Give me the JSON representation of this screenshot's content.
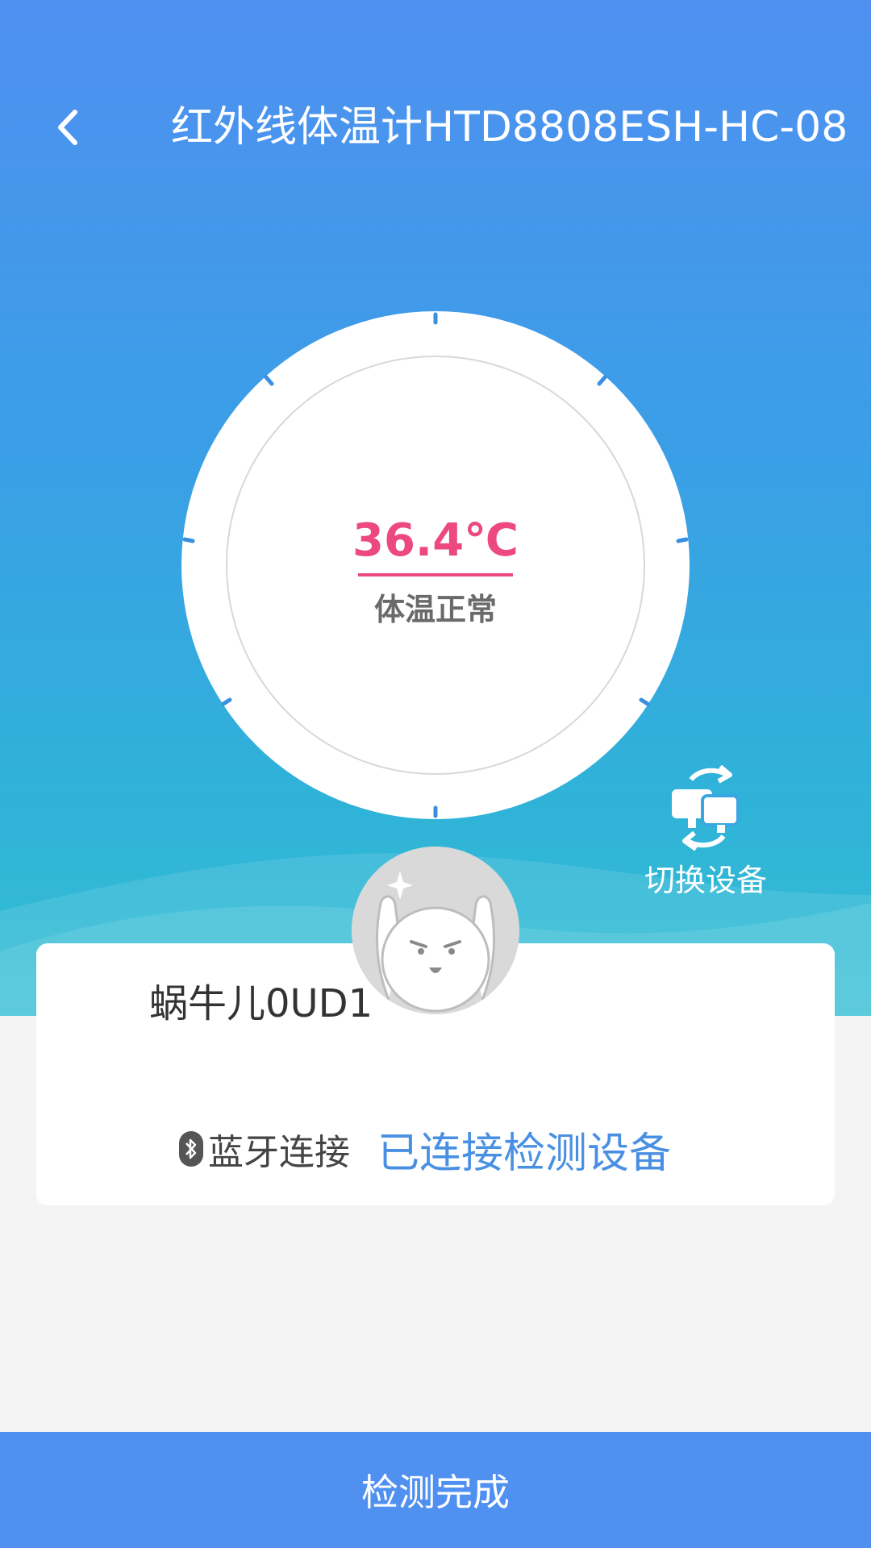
{
  "header": {
    "back_icon": "chevron-left-icon",
    "title": "红外线体温计HTD8808ESH-HC-08"
  },
  "reading": {
    "temperature": "36.4℃",
    "status": "体温正常"
  },
  "switch_device": {
    "icon": "switch-device-icon",
    "label": "切换设备"
  },
  "device_card": {
    "avatar_icon": "cartoon-avatar-icon",
    "username": "蜗牛儿0UD1",
    "bluetooth_icon": "bluetooth-icon",
    "connection_label": "蓝牙连接",
    "connection_status": "已连接检测设备"
  },
  "footer": {
    "complete_label": "检测完成"
  },
  "colors": {
    "primary_blue": "#4f90f1",
    "temperature_pink": "#ec4980",
    "link_blue": "#4a90e2"
  }
}
